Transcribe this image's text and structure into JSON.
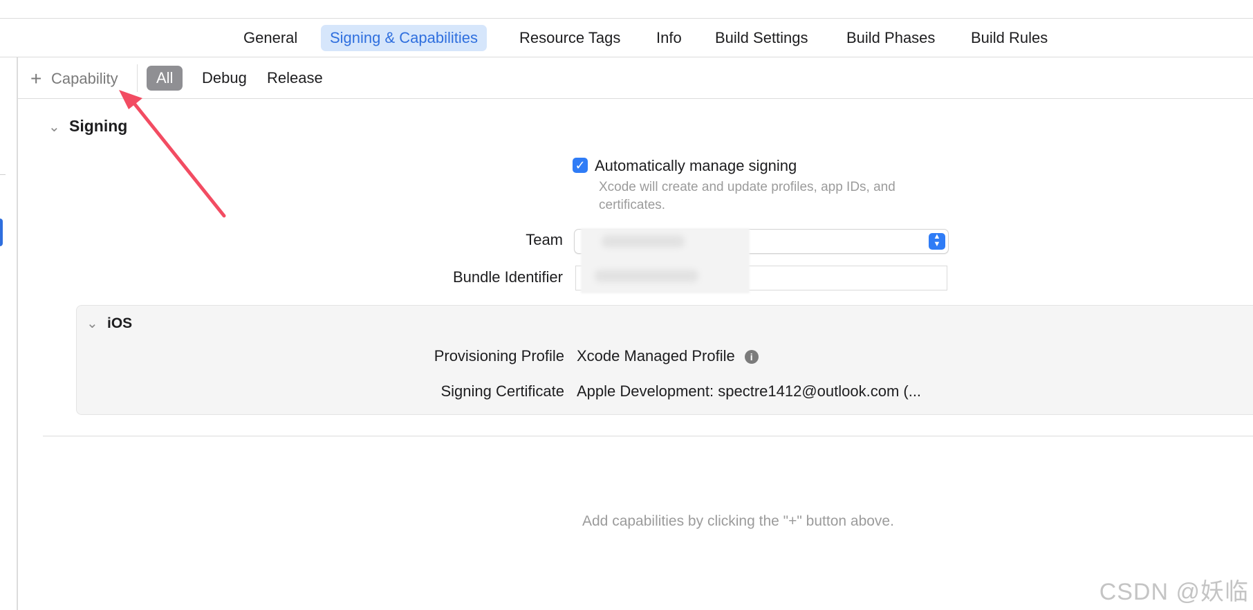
{
  "tabs": [
    {
      "label": "General",
      "active": false
    },
    {
      "label": "Signing & Capabilities",
      "active": true
    },
    {
      "label": "Resource Tags",
      "active": false
    },
    {
      "label": "Info",
      "active": false
    },
    {
      "label": "Build Settings",
      "active": false
    },
    {
      "label": "Build Phases",
      "active": false
    },
    {
      "label": "Build Rules",
      "active": false
    }
  ],
  "filter": {
    "add_capability_label": "Capability",
    "options": [
      "All",
      "Debug",
      "Release"
    ],
    "selected": "All"
  },
  "signing": {
    "section_title": "Signing",
    "auto_manage_label": "Automatically manage signing",
    "auto_manage_checked": true,
    "auto_manage_description": "Xcode will create and update profiles, app IDs, and certificates.",
    "team_label": "Team",
    "bundle_identifier_label": "Bundle Identifier"
  },
  "ios": {
    "title": "iOS",
    "provisioning_profile_label": "Provisioning Profile",
    "provisioning_profile_value": "Xcode Managed Profile",
    "signing_certificate_label": "Signing Certificate",
    "signing_certificate_value": "Apple Development: spectre1412@outlook.com (..."
  },
  "empty_hint": "Add capabilities by clicking the \"+\" button above.",
  "watermark": "CSDN @妖临",
  "colors": {
    "accent": "#2f6fde",
    "annotation_arrow": "#f24c62"
  }
}
